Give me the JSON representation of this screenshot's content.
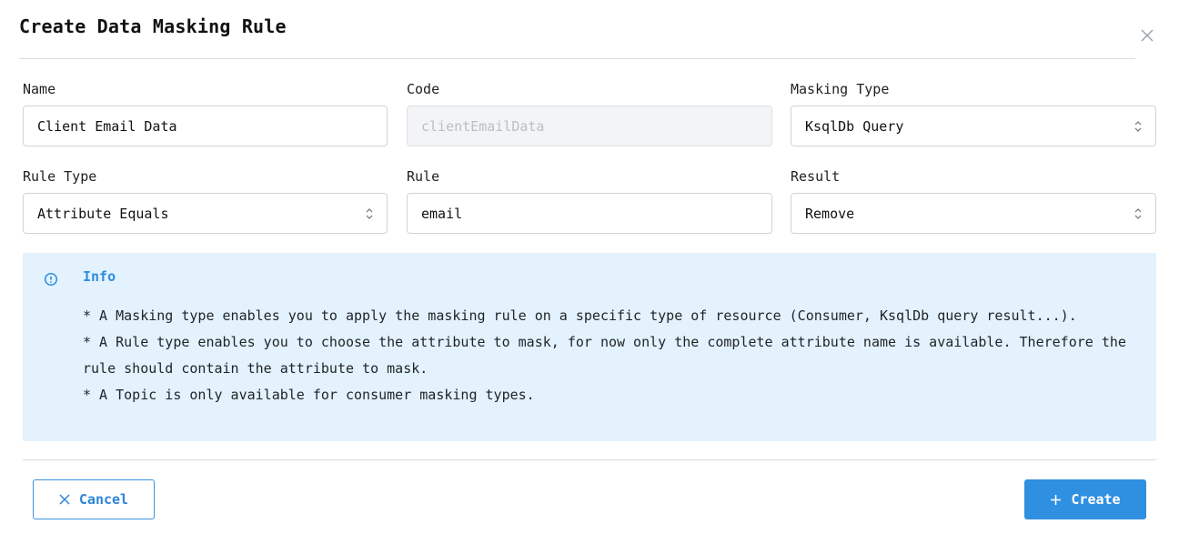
{
  "dialog": {
    "title": "Create Data Masking Rule"
  },
  "fields": {
    "name": {
      "label": "Name",
      "value": "Client Email Data"
    },
    "code": {
      "label": "Code",
      "placeholder": "clientEmailData"
    },
    "masking_type": {
      "label": "Masking Type",
      "value": "KsqlDb Query"
    },
    "rule_type": {
      "label": "Rule Type",
      "value": "Attribute Equals"
    },
    "rule": {
      "label": "Rule",
      "value": "email"
    },
    "result": {
      "label": "Result",
      "value": "Remove"
    }
  },
  "info": {
    "title": "Info",
    "lines": [
      "* A Masking type enables you to apply the masking rule on a specific type of resource (Consumer, KsqlDb query result...).",
      "* A Rule type enables you to choose the attribute to mask, for now only the complete attribute name is available. Therefore the rule should contain the attribute to mask.",
      "* A Topic is only available for consumer masking types."
    ]
  },
  "actions": {
    "cancel_label": "Cancel",
    "create_label": "Create"
  },
  "colors": {
    "accent": "#2f8fe0",
    "info_background": "#e3f2fc"
  },
  "icons": {
    "close": "close-icon",
    "info": "info-circle-icon",
    "select": "chevron-up-down-icon",
    "cancel": "x-icon",
    "create": "plus-icon"
  }
}
